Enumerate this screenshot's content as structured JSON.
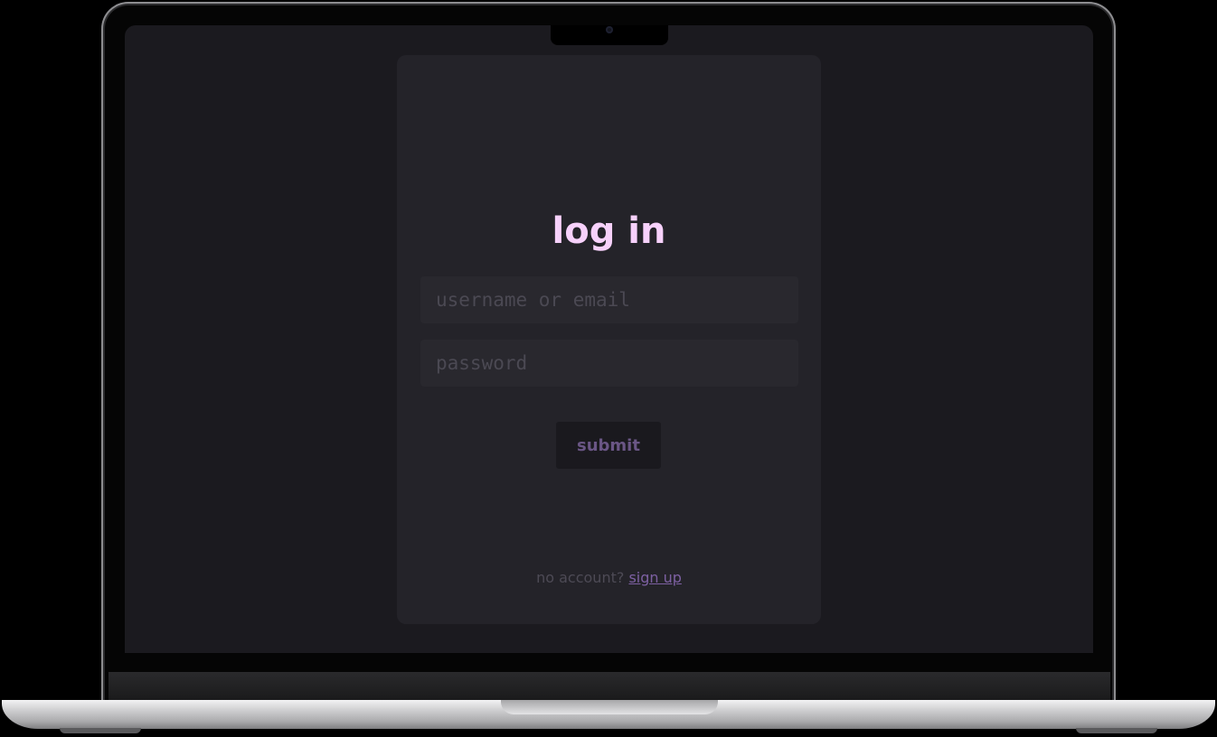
{
  "login": {
    "title": "log in",
    "username_placeholder": "username or email",
    "password_placeholder": "password",
    "submit_label": "submit",
    "no_account_text": "no account?",
    "signup_label": "sign up"
  },
  "colors": {
    "background": "#1b1a1f",
    "card": "#242329",
    "title": "#f7d1fb",
    "accent": "#7d60a2"
  }
}
